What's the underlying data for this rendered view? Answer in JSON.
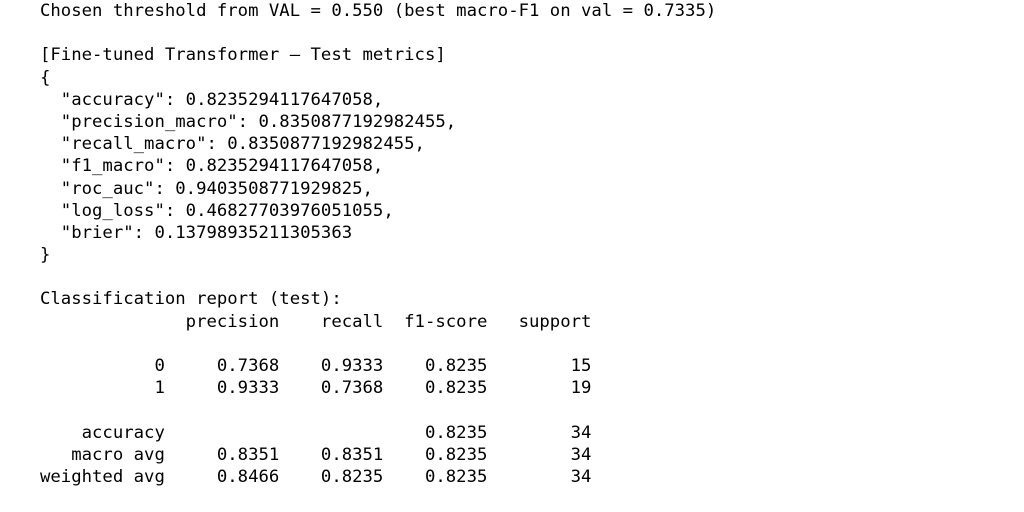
{
  "output_lines": [
    "Chosen threshold from VAL = 0.550 (best macro-F1 on val = 0.7335)",
    "",
    "[Fine-tuned Transformer — Test metrics]",
    "{",
    "  \"accuracy\": 0.8235294117647058,",
    "  \"precision_macro\": 0.8350877192982455,",
    "  \"recall_macro\": 0.8350877192982455,",
    "  \"f1_macro\": 0.8235294117647058,",
    "  \"roc_auc\": 0.9403508771929825,",
    "  \"log_loss\": 0.46827703976051055,",
    "  \"brier\": 0.13798935211305363",
    "}",
    "",
    "Classification report (test):",
    "              precision    recall  f1-score   support",
    "",
    "           0     0.7368    0.9333    0.8235        15",
    "           1     0.9333    0.7368    0.8235        19",
    "",
    "    accuracy                         0.8235        34",
    "   macro avg     0.8351    0.8351    0.8235        34",
    "weighted avg     0.8466    0.8235    0.8235        34"
  ]
}
